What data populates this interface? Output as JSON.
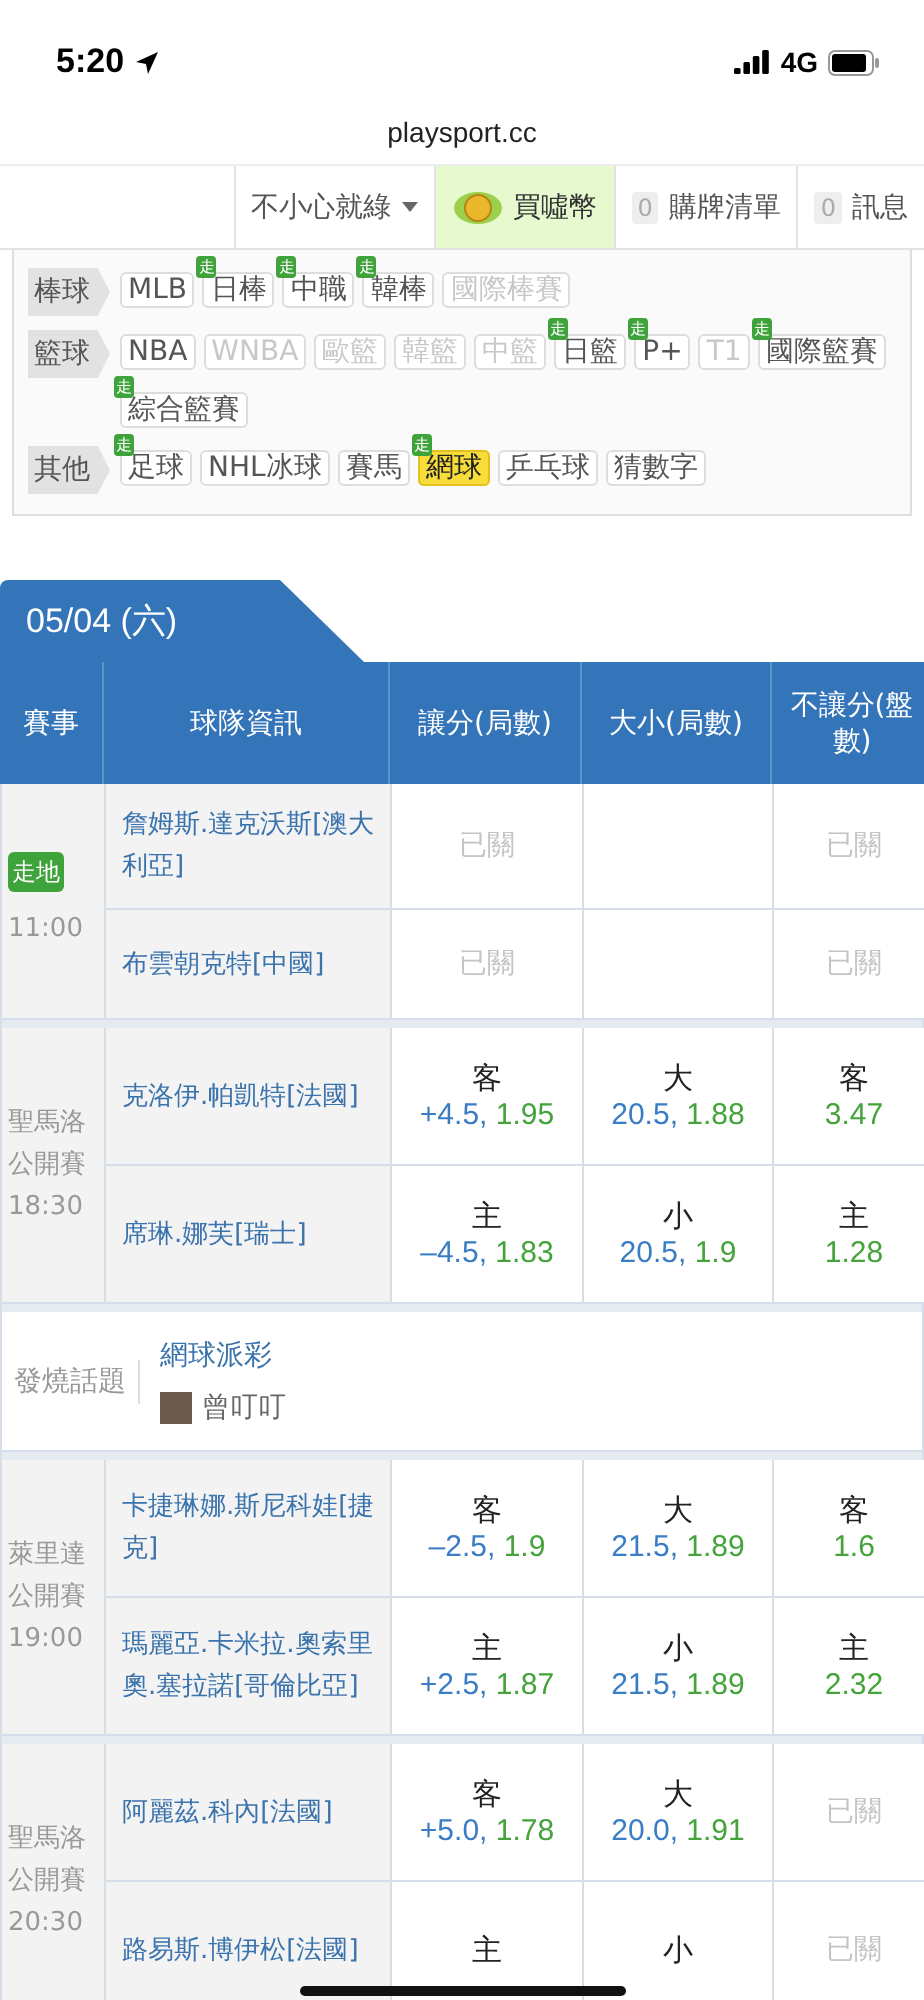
{
  "status_bar": {
    "time": "5:20",
    "network": "4G"
  },
  "address_bar": {
    "url": "playsport.cc"
  },
  "nav": {
    "user": "不小心就綠",
    "buy_coins": "買噓幣",
    "cart": {
      "count": "0",
      "label": "購牌清單"
    },
    "messages": {
      "count": "0",
      "label": "訊息"
    }
  },
  "categories": [
    {
      "label": "棒球",
      "items": [
        {
          "label": "MLB",
          "disabled": false,
          "selected": false
        },
        {
          "label": "日棒",
          "badge": "走",
          "disabled": false,
          "selected": false
        },
        {
          "label": "中職",
          "badge": "走",
          "disabled": false,
          "selected": false
        },
        {
          "label": "韓棒",
          "badge": "走",
          "disabled": false,
          "selected": false
        },
        {
          "label": "國際棒賽",
          "disabled": true,
          "selected": false
        }
      ]
    },
    {
      "label": "籃球",
      "items": [
        {
          "label": "NBA",
          "disabled": false,
          "selected": false
        },
        {
          "label": "WNBA",
          "disabled": true,
          "selected": false
        },
        {
          "label": "歐籃",
          "disabled": true,
          "selected": false
        },
        {
          "label": "韓籃",
          "disabled": true,
          "selected": false
        },
        {
          "label": "中籃",
          "disabled": true,
          "selected": false
        },
        {
          "label": "日籃",
          "badge": "走",
          "disabled": false,
          "selected": false
        },
        {
          "label": "P+",
          "badge": "走",
          "disabled": false,
          "selected": false
        },
        {
          "label": "T1",
          "disabled": true,
          "selected": false
        },
        {
          "label": "國際籃賽",
          "badge": "走",
          "disabled": false,
          "selected": false
        },
        {
          "label": "綜合籃賽",
          "badge": "走",
          "disabled": false,
          "selected": false
        }
      ]
    },
    {
      "label": "其他",
      "items": [
        {
          "label": "足球",
          "badge": "走",
          "disabled": false,
          "selected": false
        },
        {
          "label": "NHL冰球",
          "disabled": false,
          "selected": false
        },
        {
          "label": "賽馬",
          "disabled": false,
          "selected": false
        },
        {
          "label": "網球",
          "badge": "走",
          "disabled": false,
          "selected": true
        },
        {
          "label": "乒乓球",
          "disabled": false,
          "selected": false
        },
        {
          "label": "猜數字",
          "disabled": false,
          "selected": false
        }
      ]
    }
  ],
  "date_tab": "05/04 (六)",
  "columns": [
    "賽事",
    "球隊資訊",
    "讓分(局數)",
    "大小(局數)",
    "不讓分(盤數)"
  ],
  "sections": [
    {
      "kind": "match",
      "tag": "走地",
      "time": "11:00",
      "players": [
        {
          "name": "詹姆斯.達克沃斯[澳大利亞]",
          "cells": [
            {
              "kind": "closed",
              "text": "已關"
            },
            {
              "kind": "empty"
            },
            {
              "kind": "closed",
              "text": "已關"
            }
          ]
        },
        {
          "name": "布雲朝克特[中國]",
          "cells": [
            {
              "kind": "closed",
              "text": "已關"
            },
            {
              "kind": "empty"
            },
            {
              "kind": "closed",
              "text": "已關"
            }
          ]
        }
      ]
    },
    {
      "kind": "match",
      "event": "聖馬洛公開賽",
      "time": "18:30",
      "players": [
        {
          "name": "克洛伊.帕凱特[法國]",
          "cells": [
            {
              "kind": "odds",
              "side": "客",
              "line": "+4.5,",
              "odds": "1.95"
            },
            {
              "kind": "odds",
              "side": "大",
              "line": "20.5,",
              "odds": "1.88"
            },
            {
              "kind": "odds",
              "side": "客",
              "odds": "3.47"
            }
          ]
        },
        {
          "name": "席琳.娜芙[瑞士]",
          "cells": [
            {
              "kind": "odds",
              "side": "主",
              "line": "–4.5,",
              "odds": "1.83"
            },
            {
              "kind": "odds",
              "side": "小",
              "line": "20.5,",
              "odds": "1.9"
            },
            {
              "kind": "odds",
              "side": "主",
              "odds": "1.28"
            }
          ]
        }
      ]
    },
    {
      "kind": "topic",
      "label": "發燒話題",
      "title": "網球派彩",
      "author": "曾叮叮"
    },
    {
      "kind": "match",
      "event": "萊里達公開賽",
      "time": "19:00",
      "players": [
        {
          "name": "卡捷琳娜.斯尼科娃[捷克]",
          "cells": [
            {
              "kind": "odds",
              "side": "客",
              "line": "–2.5,",
              "odds": "1.9"
            },
            {
              "kind": "odds",
              "side": "大",
              "line": "21.5,",
              "odds": "1.89"
            },
            {
              "kind": "odds",
              "side": "客",
              "odds": "1.6"
            }
          ]
        },
        {
          "name": "瑪麗亞.卡米拉.奧索里奧.塞拉諾[哥倫比亞]",
          "cells": [
            {
              "kind": "odds",
              "side": "主",
              "line": "+2.5,",
              "odds": "1.87"
            },
            {
              "kind": "odds",
              "side": "小",
              "line": "21.5,",
              "odds": "1.89"
            },
            {
              "kind": "odds",
              "side": "主",
              "odds": "2.32"
            }
          ]
        }
      ]
    },
    {
      "kind": "match",
      "event": "聖馬洛公開賽",
      "time": "20:30",
      "players": [
        {
          "name": "阿麗茲.科內[法國]",
          "cells": [
            {
              "kind": "odds",
              "side": "客",
              "line": "+5.0,",
              "odds": "1.78"
            },
            {
              "kind": "odds",
              "side": "大",
              "line": "20.0,",
              "odds": "1.91"
            },
            {
              "kind": "closed",
              "text": "已關"
            }
          ]
        },
        {
          "name": "路易斯.博伊松[法國]",
          "cells": [
            {
              "kind": "odds",
              "side": "主"
            },
            {
              "kind": "odds",
              "side": "小"
            },
            {
              "kind": "closed",
              "text": "已關"
            }
          ]
        }
      ]
    }
  ]
}
